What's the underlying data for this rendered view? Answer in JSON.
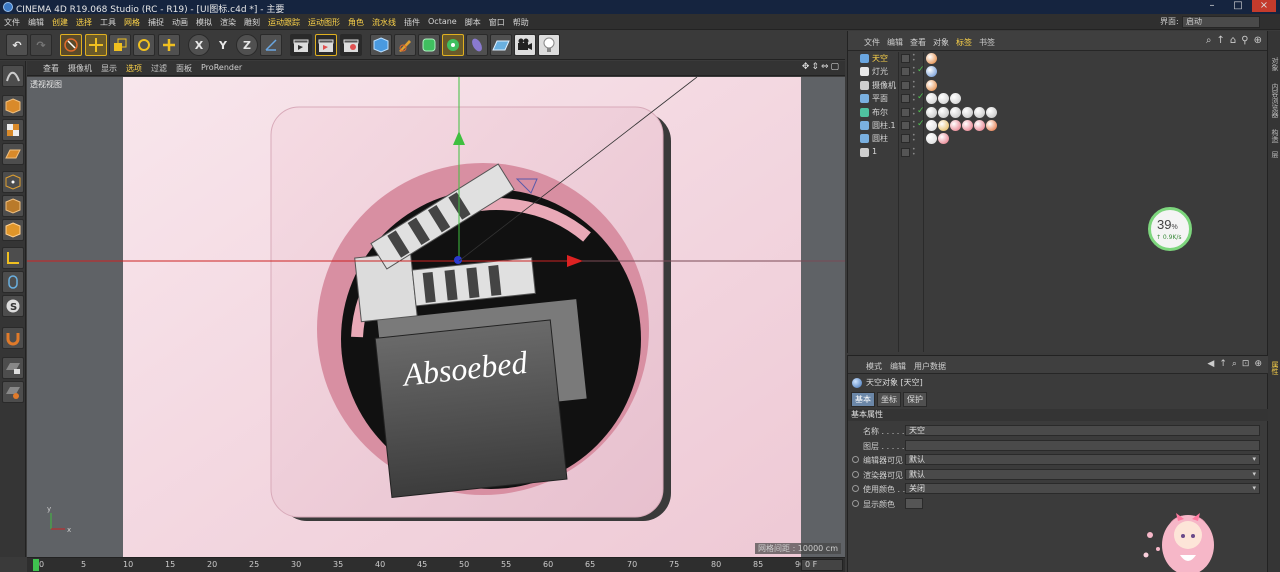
{
  "window": {
    "title": "CINEMA 4D R19.068 Studio (RC - R19) - [UI图标.c4d *] - 主要"
  },
  "menubar": {
    "items": [
      "文件",
      "编辑",
      "创建",
      "选择",
      "工具",
      "网格",
      "捕捉",
      "动画",
      "模拟",
      "渲染",
      "雕刻",
      "运动跟踪",
      "运动图形",
      "角色",
      "流水线",
      "插件",
      "Octane",
      "脚本",
      "窗口",
      "帮助"
    ],
    "highlight_index": [
      2,
      3,
      5,
      11,
      12,
      13,
      14
    ],
    "layout_label": "界面:",
    "layout_value": "启动"
  },
  "toolbar": {
    "buttons": [
      "undo",
      "redo",
      "live-select",
      "move",
      "scale",
      "rotate",
      "move-plus",
      "x-axis",
      "y-axis",
      "z-axis",
      "coord-system",
      "render-view",
      "render-picture",
      "render-settings",
      "cube",
      "pen",
      "subdivide",
      "array",
      "deformer",
      "floor",
      "camera",
      "light"
    ],
    "axis_x": "X",
    "axis_y": "Y",
    "axis_z": "Z"
  },
  "lefttools": [
    "make-editable",
    "texture-mode",
    "points",
    "edges",
    "polygons",
    "model",
    "axis",
    "tweak",
    "snap",
    "magnet",
    "workplane",
    "locked-workplane"
  ],
  "viewport_menu": {
    "items": [
      "查看",
      "摄像机",
      "显示",
      "选项",
      "过滤",
      "面板",
      "ProRender"
    ],
    "highlight_index": 3
  },
  "viewport": {
    "label": "透视视图",
    "scale": "网格间距 : 10000 cm",
    "scene_text": "Absoebed"
  },
  "timeline": {
    "ticks": [
      "0",
      "5",
      "10",
      "15",
      "20",
      "25",
      "30",
      "35",
      "40",
      "45",
      "50",
      "55",
      "60",
      "65",
      "70",
      "75",
      "80",
      "85",
      "90"
    ],
    "frame": "0 F"
  },
  "object_manager": {
    "menu": [
      "文件",
      "编辑",
      "查看",
      "对象",
      "标签",
      "书签"
    ],
    "menu_highlight": 4,
    "objects": [
      {
        "name": "天空",
        "icon_color": "#6aa6e0",
        "highlight": true,
        "check": false,
        "tags": [
          "#e07a2a"
        ]
      },
      {
        "name": "灯光",
        "icon_color": "#e8e8e8",
        "highlight": false,
        "check": true,
        "tags": [
          "#5a8ad0"
        ]
      },
      {
        "name": "摄像机",
        "icon_color": "#cfcfcf",
        "highlight": false,
        "check": false,
        "tags": [
          "#e07a2a"
        ]
      },
      {
        "name": "平面",
        "icon_color": "#7ab0e0",
        "highlight": false,
        "check": true,
        "tags": [
          "#c9c9c9",
          "#c9c9c9",
          "#c9c9c9"
        ]
      },
      {
        "name": "布尔",
        "icon_color": "#4fc2a0",
        "highlight": false,
        "check": true,
        "tags": [
          "#bbbbbb",
          "#bbbbbb",
          "#bbbbbb",
          "#bbbbbb",
          "#bbbbbb",
          "#bbbbbb"
        ]
      },
      {
        "name": "圆柱.1",
        "icon_color": "#7ab0e0",
        "highlight": false,
        "check": true,
        "tags": [
          "#d8d8d8",
          "#e3b24a",
          "#e36a7a",
          "#e36a7a",
          "#e36a7a",
          "#e0622a"
        ]
      },
      {
        "name": "圆柱",
        "icon_color": "#7ab0e0",
        "highlight": false,
        "check": false,
        "tags": [
          "#d8d8d8",
          "#e36a7a"
        ]
      },
      {
        "name": "1",
        "icon_color": "#cfcfcf",
        "highlight": false,
        "check": false,
        "tags": []
      }
    ]
  },
  "net_widget": {
    "percent": "39",
    "percent_unit": "%",
    "speed": "↑ 0.9K/s"
  },
  "side_tabs": [
    "对象",
    "内容浏览器",
    "构造",
    "层"
  ],
  "side_tabs_bottom": [
    "属性"
  ],
  "attribute_manager": {
    "menu": [
      "模式",
      "编辑",
      "用户数据"
    ],
    "title": "天空对象 [天空]",
    "tabs": [
      "基本",
      "坐标",
      "保护"
    ],
    "section": "基本属性",
    "rows": [
      {
        "label": "名称 . . . . . .",
        "value": "天空",
        "radio": false,
        "dropdown": false
      },
      {
        "label": "图层 . . . . . .",
        "value": "",
        "radio": false,
        "dropdown": false
      },
      {
        "label": "编辑器可见",
        "value": "默认",
        "radio": true,
        "dropdown": true
      },
      {
        "label": "渲染器可见",
        "value": "默认",
        "radio": true,
        "dropdown": true
      },
      {
        "label": "使用颜色 . . .",
        "value": "关闭",
        "radio": true,
        "dropdown": true
      },
      {
        "label": "显示颜色",
        "value": "",
        "radio": true,
        "dropdown": false
      }
    ]
  },
  "colors": {
    "accent": "#ffd54a",
    "viewport_bg": "#f3dbe3",
    "title_bar": "#15243f"
  }
}
